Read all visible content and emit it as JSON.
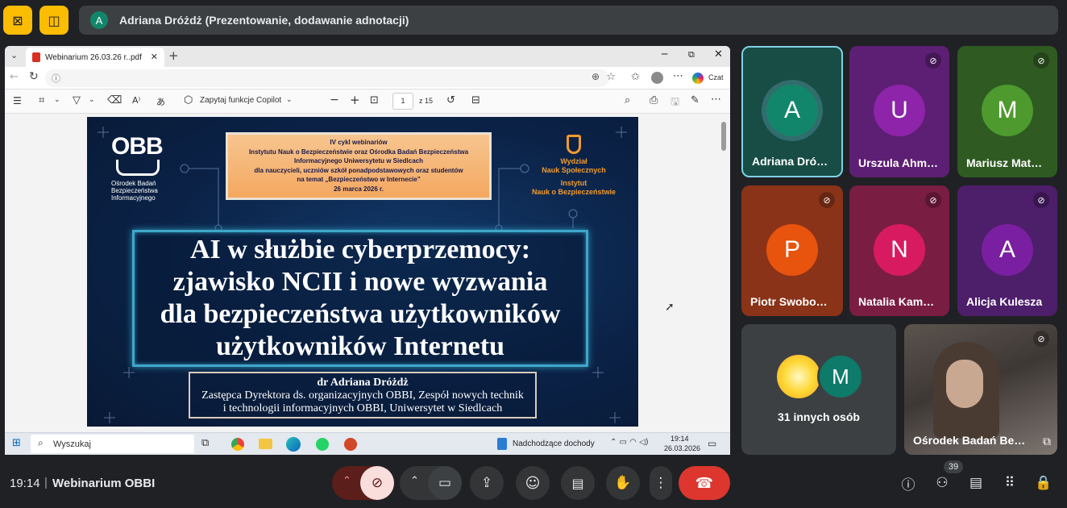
{
  "presenter": {
    "initial": "A",
    "text": "Adriana Dróżdż (Prezentowanie, dodawanie adnotacji)",
    "avatar_color": "#12866a"
  },
  "browser": {
    "tab_title": "Webinarium 26.03.26 r..pdf",
    "copilot_label": "Czat",
    "toolbar": {
      "copilot_feature": "Zapytaj funkcje Copilot",
      "page_current": "1",
      "page_total": "z 15"
    }
  },
  "slide": {
    "org_logo": "OBB",
    "org_name_1": "Ośrodek Badań",
    "org_name_2": "Bezpieczeństwa",
    "org_name_3": "Informacyjnego",
    "banner_lines": [
      "IV cykl webinariów",
      "Instytutu Nauk o Bezpieczeństwie oraz Ośrodka Badań Bezpieczeństwa",
      "Informacyjnego Uniwersytetu w Siedlcach",
      "dla nauczycieli, uczniów szkół ponadpodstawowych oraz studentów",
      "na temat „Bezpieczeństwo w Internecie”",
      "26 marca 2026 r."
    ],
    "faculty_1": "Wydział",
    "faculty_2": "Nauk Społecznych",
    "institute_1": "Instytut",
    "institute_2": "Nauk o Bezpieczeństwie",
    "title_lines": [
      "AI w służbie cyberprzemocy:",
      "zjawisko NCII i nowe wyzwania",
      "dla bezpieczeństwa użytkowników",
      "użytkowników Internetu"
    ],
    "speaker_name": "dr Adriana Dróżdż",
    "speaker_role_1": "Zastępca Dyrektora ds. organizacyjnych OBBI, Zespół nowych technik",
    "speaker_role_2": "i technologii informacyjnych OBBI, Uniwersytet w Siedlcach"
  },
  "taskbar": {
    "search": "Wyszukaj",
    "notification": "Nadchodzące dochody",
    "time": "19:14",
    "date": "26.03.2026"
  },
  "participants": [
    {
      "initial": "A",
      "name": "Adriana Dró…",
      "color": "#12866a",
      "bg": "#174d45"
    },
    {
      "initial": "U",
      "name": "Urszula Ahm…",
      "color": "#8e24aa",
      "bg": "#5d1f73"
    },
    {
      "initial": "M",
      "name": "Mariusz Mat…",
      "color": "#4e9a2e",
      "bg": "#2f5a22"
    },
    {
      "initial": "P",
      "name": "Piotr Swobo…",
      "color": "#e8530e",
      "bg": "#8a3318"
    },
    {
      "initial": "N",
      "name": "Natalia Kam…",
      "color": "#d81b60",
      "bg": "#7a1d43"
    },
    {
      "initial": "A",
      "name": "Alicja Kulesza",
      "color": "#7b1fa2",
      "bg": "#4d1e6a"
    }
  ],
  "others": {
    "initial": "M",
    "label": "31 innych osób"
  },
  "self_tile": {
    "name": "Ośrodek Badań Be…"
  },
  "meeting": {
    "time": "19:14",
    "name": "Webinarium OBBI",
    "participant_count": "39"
  }
}
